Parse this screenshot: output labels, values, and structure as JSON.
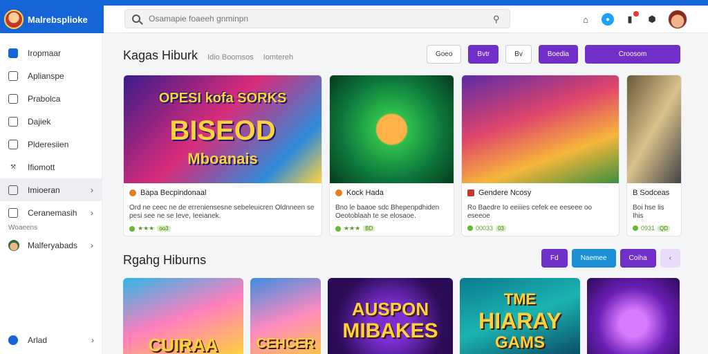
{
  "app": {
    "brand": "Malrebsplioke"
  },
  "search": {
    "placeholder": "Osamapie foaeeh gnminpn"
  },
  "sidebar": {
    "items": [
      {
        "label": "Iropmaar"
      },
      {
        "label": "Aplianspe"
      },
      {
        "label": "Prabolca"
      },
      {
        "label": "Dajiek"
      },
      {
        "label": "Plderesiien"
      },
      {
        "label": "Ifiomott"
      },
      {
        "label": "Imioeran"
      },
      {
        "label": "Ceranemasih"
      }
    ],
    "section_label": "Woaeens",
    "profile_item": "Malferyabads",
    "bottom_item": "Arlad"
  },
  "section1": {
    "title": "Kagas Hiburk",
    "subtitle_a": "Idio Boomsos",
    "subtitle_b": "Iomtereh",
    "buttons": [
      "Goeo",
      "Bvtr",
      "Bv",
      "Boedia",
      "Croosom"
    ]
  },
  "cards": [
    {
      "art_line1": "OPESI kofa SORKS",
      "art_line2": "BISEOD",
      "art_line3": "Mboanais",
      "title": "Bapa Becpindonaal",
      "desc": "Ord ne ceec ne de erreniensesne sebeleuicren Oldnneen se pesi see ne se Ieve, Ieeianek.",
      "rating": "★★★",
      "badge": "oo3"
    },
    {
      "title": "Kock Hada",
      "desc": "Bno le baaoe sdc Bhepenpdhiden Oeotoblaah te se elosaoe.",
      "rating": "★★★",
      "badge": "BD"
    },
    {
      "title": "Gendere Ncosy",
      "desc": "Ro Baedre Io eeiiies cefek ee eeseee oo eseeoe",
      "rating": "00033",
      "badge": "03"
    },
    {
      "title": "B Sodceas",
      "desc": "Boi hse lis Ihis",
      "rating": "0931",
      "badge": "QD"
    }
  ],
  "section2": {
    "title": "Rgahg Hiburns",
    "buttons": [
      "Fd",
      "Naemee",
      "Coiha",
      "‹"
    ]
  },
  "cards2": [
    {
      "art": "CUIRAA"
    },
    {
      "art": "CEHCER"
    },
    {
      "art_line1": "AUSPON",
      "art_line2": "MIBAKES"
    },
    {
      "art_line1": "TME",
      "art_line2": "HIARAY",
      "art_line3": "GAMS"
    },
    {
      "art": ""
    }
  ],
  "colors": {
    "brand": "#1565d8",
    "accent": "#6f2fc8",
    "secondary": "#1a8fd6"
  }
}
